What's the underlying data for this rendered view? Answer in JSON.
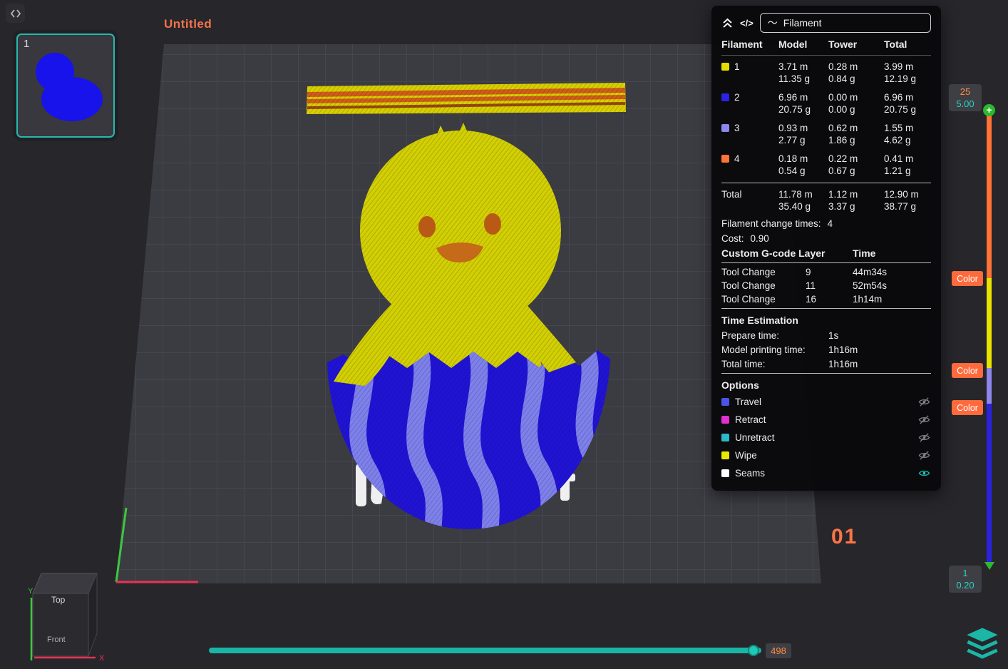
{
  "window": {
    "title": "Untitled"
  },
  "icons": {
    "code_icon": "</>",
    "wave_icon": "〜",
    "plus_icon": "+"
  },
  "plate": {
    "thumbnail_number": "1",
    "plate_label": "01"
  },
  "viewcube": {
    "top": "Top",
    "front": "Front",
    "axis_x": "X",
    "axis_y": "Y"
  },
  "filament_panel": {
    "view_mode": "Filament",
    "table": {
      "headers": [
        "Filament",
        "Model",
        "Tower",
        "Total"
      ],
      "rows": [
        {
          "id": "1",
          "color": "#e3de00",
          "model_m": "3.71 m",
          "model_g": "11.35 g",
          "tower_m": "0.28 m",
          "tower_g": "0.84 g",
          "total_m": "3.99 m",
          "total_g": "12.19 g"
        },
        {
          "id": "2",
          "color": "#2b22e6",
          "model_m": "6.96 m",
          "model_g": "20.75 g",
          "tower_m": "0.00 m",
          "tower_g": "0.00 g",
          "total_m": "6.96 m",
          "total_g": "20.75 g"
        },
        {
          "id": "3",
          "color": "#8d86ec",
          "model_m": "0.93 m",
          "model_g": "2.77 g",
          "tower_m": "0.62 m",
          "tower_g": "1.86 g",
          "total_m": "1.55 m",
          "total_g": "4.62 g"
        },
        {
          "id": "4",
          "color": "#ff7435",
          "model_m": "0.18 m",
          "model_g": "0.54 g",
          "tower_m": "0.22 m",
          "tower_g": "0.67 g",
          "total_m": "0.41 m",
          "total_g": "1.21 g"
        }
      ],
      "total": {
        "label": "Total",
        "model_m": "11.78 m",
        "model_g": "35.40 g",
        "tower_m": "1.12 m",
        "tower_g": "3.37 g",
        "total_m": "12.90 m",
        "total_g": "38.77 g"
      }
    },
    "change_times_label": "Filament change times:",
    "change_times_value": "4",
    "cost_label": "Cost:",
    "cost_value": "0.90",
    "gcode": {
      "header_layer": "Custom G-code Layer",
      "header_time": "Time",
      "rows": [
        {
          "label": "Tool Change",
          "layer": "9",
          "time": "44m34s"
        },
        {
          "label": "Tool Change",
          "layer": "11",
          "time": "52m54s"
        },
        {
          "label": "Tool Change",
          "layer": "16",
          "time": "1h14m"
        }
      ]
    },
    "time_estimation": {
      "header": "Time Estimation",
      "rows": [
        {
          "label": "Prepare time:",
          "value": "1s"
        },
        {
          "label": "Model printing time:",
          "value": "1h16m"
        },
        {
          "label": "Total time:",
          "value": "1h16m"
        }
      ]
    },
    "options": {
      "header": "Options",
      "items": [
        {
          "label": "Travel",
          "color": "#4a55e8",
          "visible": false
        },
        {
          "label": "Retract",
          "color": "#e22fd0",
          "visible": false
        },
        {
          "label": "Unretract",
          "color": "#2bb8c8",
          "visible": false
        },
        {
          "label": "Wipe",
          "color": "#e8e800",
          "visible": false
        },
        {
          "label": "Seams",
          "color": "#ffffff",
          "visible": true
        }
      ]
    }
  },
  "layer_slider": {
    "top_line1": "25",
    "top_line2": "5.00",
    "bottom_line1": "1",
    "bottom_line2": "0.20",
    "color_label": "Color"
  },
  "hslider": {
    "value": "498"
  },
  "colors": {
    "accent_teal": "#19b5a8",
    "accent_orange": "#ff7446",
    "filament_1": "#e3de00",
    "filament_2": "#2b22e6",
    "filament_3": "#8d86ec",
    "filament_4": "#ff7435"
  }
}
